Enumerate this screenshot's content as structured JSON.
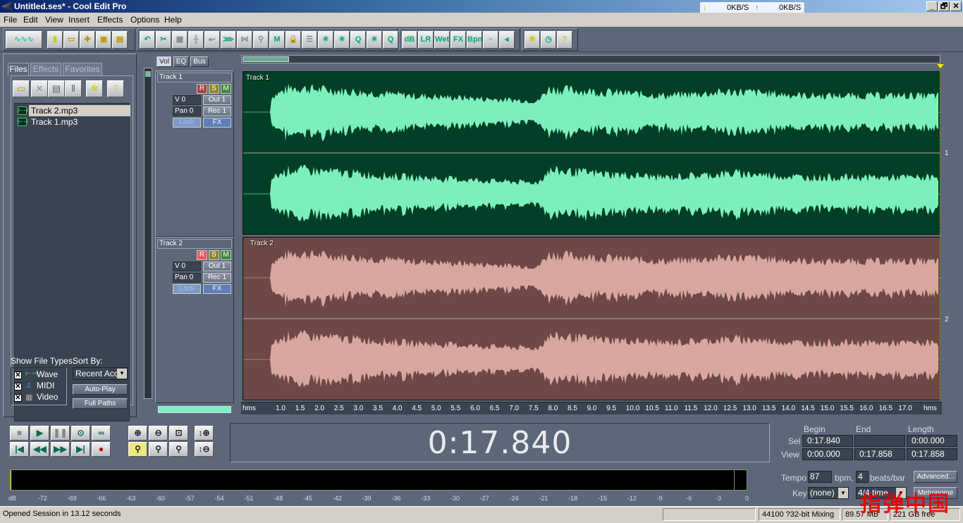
{
  "window": {
    "title": "Untitled.ses* - Cool Edit Pro",
    "controls": [
      "_",
      "🗗",
      "✕"
    ]
  },
  "netmeter": {
    "down": "0KB/S",
    "up": "0KB/S"
  },
  "menu": [
    "File",
    "Edit",
    "View",
    "Insert",
    "Effects",
    "Options",
    "Help"
  ],
  "toolbar": {
    "groups": [
      [
        "toggle-waveform-view"
      ],
      [
        "new",
        "open",
        "insert",
        "save",
        "save-all"
      ],
      [
        "undo",
        "cut",
        "copy-edit",
        "split",
        "route",
        "merge",
        "delete",
        "mix",
        "insert-mix",
        "lock",
        "align",
        "time-stretch",
        "pitch",
        "quantize",
        "loop",
        "queue"
      ],
      [
        "volume-envelope",
        "pan-envelope",
        "wet-envelope",
        "fx-envelope",
        "bpm-envelope",
        "snap",
        "punch"
      ],
      [
        "settings",
        "lock-time",
        "help"
      ]
    ],
    "group4_labels": [
      "dB",
      "LR",
      "Wet",
      "FX",
      "Bpm",
      "",
      "⫷"
    ]
  },
  "organizer": {
    "tabs": [
      "Files",
      "Effects",
      "Favorites"
    ],
    "active_tab": "Files",
    "files": [
      {
        "name": "Track 2.mp3",
        "selected": true
      },
      {
        "name": "Track 1.mp3",
        "selected": false
      }
    ],
    "show_file_types_label": "Show File Types:",
    "file_types": [
      {
        "label": "Wave",
        "checked": true
      },
      {
        "label": "MIDI",
        "checked": true
      },
      {
        "label": "Video",
        "checked": true
      }
    ],
    "sort_by_label": "Sort By:",
    "sort_by_value": "Recent Acc",
    "auto_play": "Auto-Play",
    "full_paths": "Full Paths"
  },
  "mixer": {
    "tabs": [
      "Vol",
      "EQ",
      "Bus"
    ],
    "active_tab": "Vol",
    "tracks": [
      {
        "name": "Track 1",
        "r": "R",
        "s": "S",
        "m": "M",
        "vol": "V 0",
        "pan": "Pan 0",
        "out": "Out 1",
        "rec": "Rec 1",
        "lock": "Lock",
        "fx": "FX",
        "record_armed": false
      },
      {
        "name": "Track 2",
        "r": "R",
        "s": "S",
        "m": "M",
        "vol": "V 0",
        "pan": "Pan 0",
        "out": "Out 1",
        "rec": "Rec 1",
        "lock": "Lock",
        "fx": "FX",
        "record_armed": true
      }
    ]
  },
  "tracks": [
    {
      "label": "Track 1",
      "number": "1",
      "color": "#7cf0bc",
      "bg": "#033f28"
    },
    {
      "label": "Track 2",
      "number": "2",
      "color": "#d8a6a0",
      "bg": "#6e4846"
    }
  ],
  "ruler": {
    "unit": "hms",
    "ticks": [
      "1.0",
      "1.5",
      "2.0",
      "2.5",
      "3.0",
      "3.5",
      "4.0",
      "4.5",
      "5.0",
      "5.5",
      "6.0",
      "6.5",
      "7.0",
      "7.5",
      "8.0",
      "8.5",
      "9.0",
      "9.5",
      "10.0",
      "10.5",
      "11.0",
      "11.5",
      "12.0",
      "12.5",
      "13.0",
      "13.5",
      "14.0",
      "14.5",
      "15.0",
      "15.5",
      "16.0",
      "16.5",
      "17.0"
    ],
    "end_label": "hms"
  },
  "transport": {
    "row1": [
      "stop",
      "play",
      "pause",
      "play-to-end",
      "loop"
    ],
    "row2": [
      "go-to-start",
      "rewind",
      "fast-forward",
      "go-to-end",
      "record"
    ]
  },
  "zoom": {
    "row1": [
      "zoom-in-h",
      "zoom-out-h",
      "zoom-full"
    ],
    "row2": [
      "zoom-left-sel",
      "zoom-right-sel",
      "zoom-sel"
    ],
    "vertical": [
      "zoom-in-v",
      "zoom-out-v"
    ]
  },
  "time_display": "0:17.840",
  "selection": {
    "headers": [
      "Begin",
      "End",
      "Length"
    ],
    "rows": [
      {
        "label": "Sel",
        "begin": "0:17.840",
        "end": "",
        "length": "0:00.000"
      },
      {
        "label": "View",
        "begin": "0:00.000",
        "end": "0:17.858",
        "length": "0:17.858"
      }
    ]
  },
  "meter": {
    "ticks": [
      "dB",
      "-72",
      "-69",
      "-66",
      "-63",
      "-60",
      "-57",
      "-54",
      "-51",
      "-48",
      "-45",
      "-42",
      "-39",
      "-36",
      "-33",
      "-30",
      "-27",
      "-24",
      "-21",
      "-18",
      "-15",
      "-12",
      "-9",
      "-6",
      "-3",
      "0"
    ]
  },
  "tempo": {
    "tempo_label": "Tempo",
    "tempo_value": "87",
    "bpm_label": "bpm,",
    "beats_value": "4",
    "beats_label": "beats/bar",
    "advanced": "Advanced...",
    "key_label": "Key",
    "key_value": "(none)",
    "time_sig": "4/4 time",
    "metronome": "Metronome"
  },
  "status": {
    "message": "Opened Session in 13.12 seconds",
    "format": "44100 ?32-bit Mixing",
    "memory": "89.57 MB",
    "disk": "221 GB free"
  },
  "watermark": "指弹中国"
}
